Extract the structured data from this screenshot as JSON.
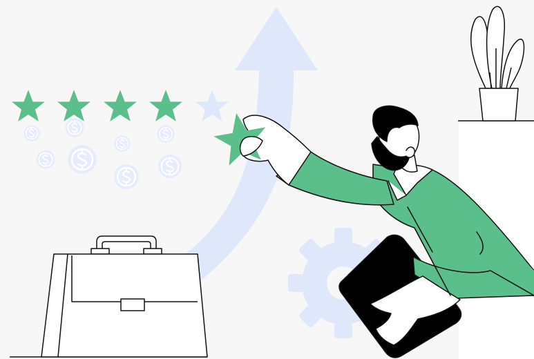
{
  "illustration": {
    "rating": {
      "value": 4,
      "max": 5
    },
    "colors": {
      "background": "#f7f7f8",
      "accent_green": "#5bbf8c",
      "pale_blue": "#dfe7fb",
      "coin_blue": "#e6ecfc",
      "outline": "#111111",
      "skin": "#ffffff",
      "hair": "#000000"
    },
    "icons": [
      "star-icon",
      "dollar-coin-icon",
      "growth-arrow-icon",
      "briefcase-icon",
      "gear-icon",
      "potted-plant-icon",
      "tablet-icon"
    ]
  }
}
